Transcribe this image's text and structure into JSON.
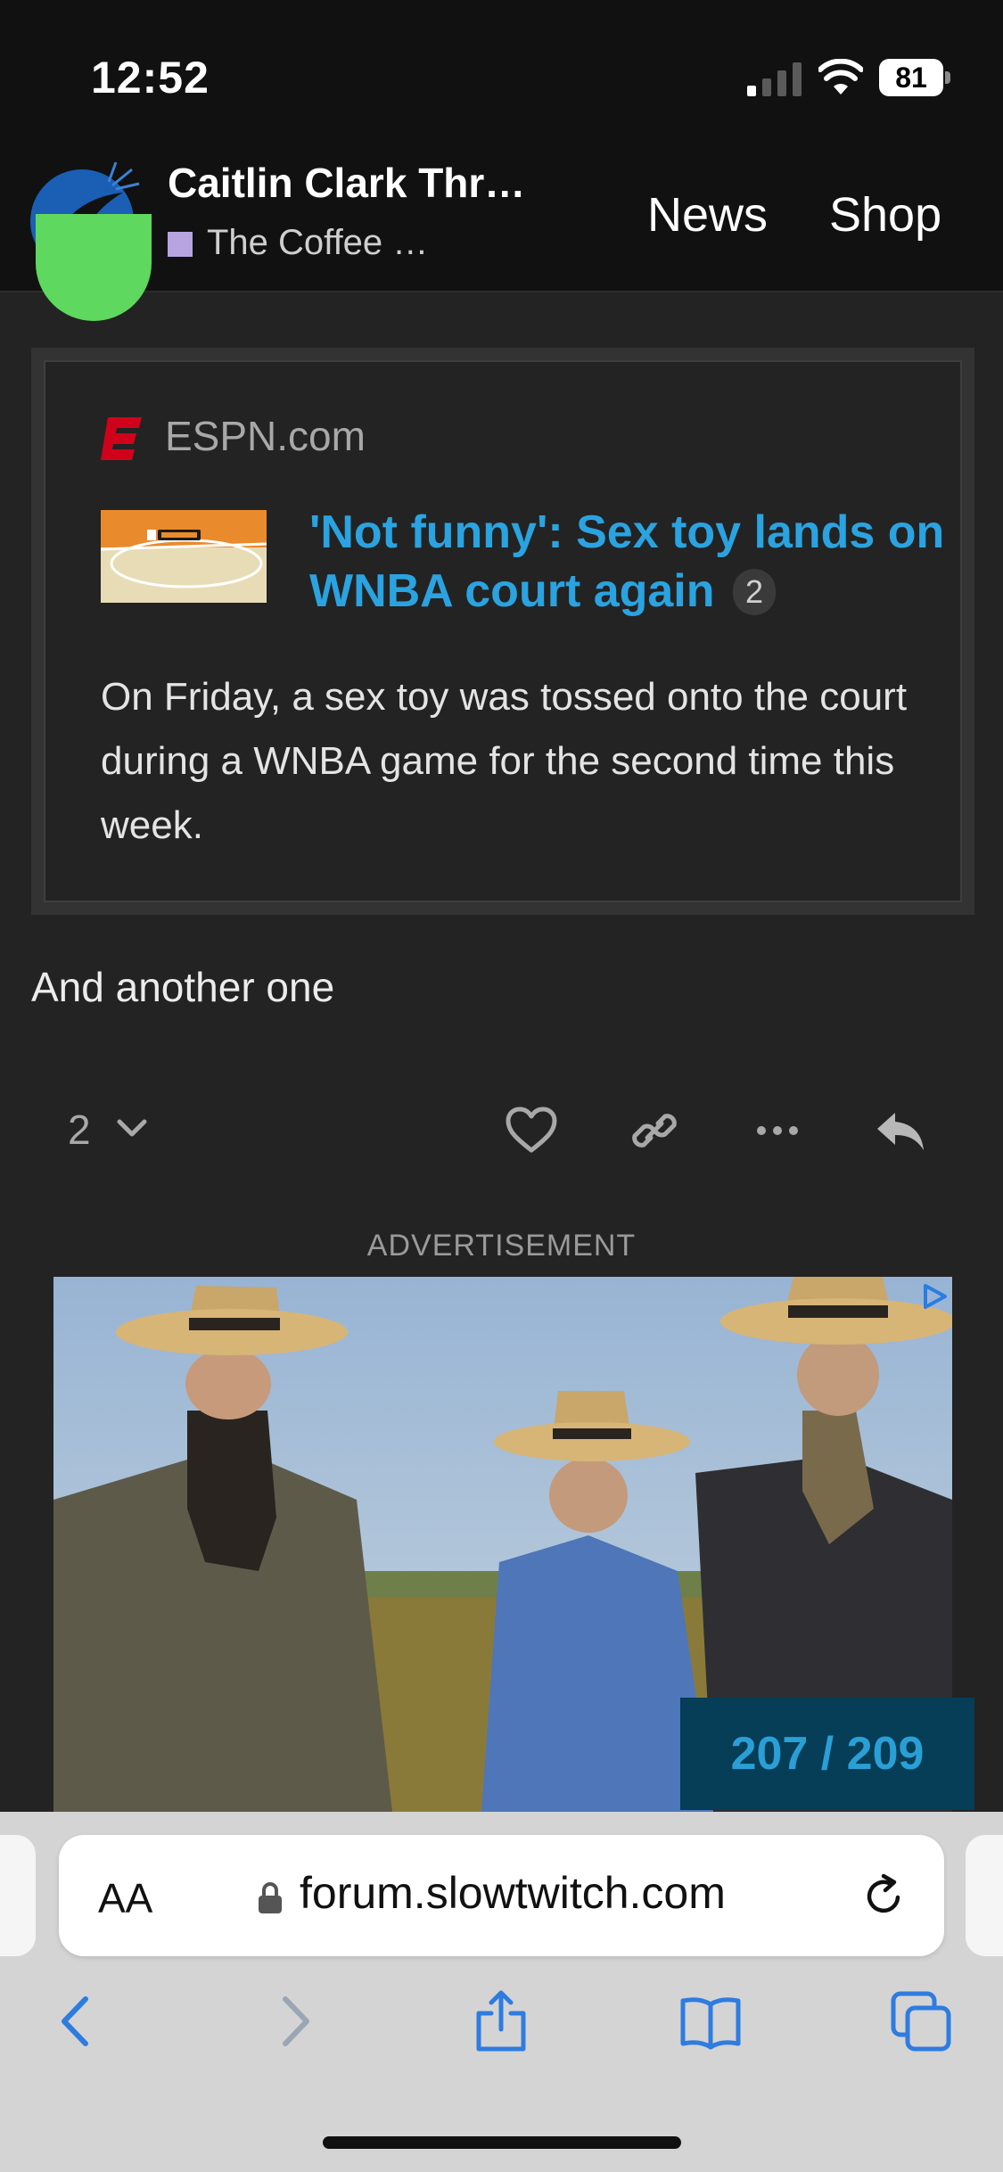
{
  "status_bar": {
    "time": "12:52",
    "battery_level": "81"
  },
  "header": {
    "thread_title": "Caitlin Clark Thr…",
    "category_name": "The Coffee …",
    "category_color": "#b8a4e0",
    "nav": {
      "news_label": "News",
      "shop_label": "Shop"
    }
  },
  "onebox": {
    "source": "ESPN.com",
    "source_icon": "espn-icon",
    "title": "'Not funny': Sex toy lands on WNBA court again",
    "click_count": "2",
    "excerpt": "On Friday, a sex toy was tossed onto the court during a WNBA game for the second time this week.",
    "link_color": "#2aa3e0"
  },
  "post": {
    "text": "And another one",
    "like_count": "2",
    "actions": [
      "heart-icon",
      "link-icon",
      "more-icon",
      "reply-icon"
    ]
  },
  "advertisement": {
    "label": "ADVERTISEMENT"
  },
  "progress": {
    "current": 207,
    "total": 209,
    "label": "207 / 209"
  },
  "browser": {
    "text_size_label": "AA",
    "url": "forum.slowtwitch.com",
    "toolbar": [
      "back-icon",
      "forward-icon",
      "share-icon",
      "bookmarks-icon",
      "tabs-icon"
    ]
  }
}
